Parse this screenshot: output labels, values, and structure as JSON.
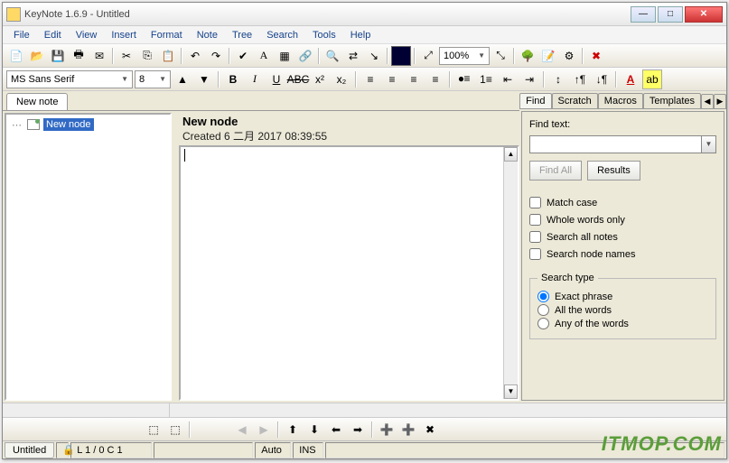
{
  "window": {
    "title": "KeyNote 1.6.9 - Untitled"
  },
  "menu": [
    "File",
    "Edit",
    "View",
    "Insert",
    "Format",
    "Note",
    "Tree",
    "Search",
    "Tools",
    "Help"
  ],
  "format": {
    "font": "MS Sans Serif",
    "size": "8",
    "zoom": "100%"
  },
  "note_tab": "New note",
  "tree": {
    "selected": "New node"
  },
  "editor": {
    "title": "New node",
    "created": "Created 6 二月 2017 08:39:55"
  },
  "find_panel": {
    "tabs": [
      "Find",
      "Scratch",
      "Macros",
      "Templates"
    ],
    "label": "Find text:",
    "value": "",
    "btn_findall": "Find All",
    "btn_results": "Results",
    "chk_match": "Match case",
    "chk_whole": "Whole words only",
    "chk_allnotes": "Search all notes",
    "chk_nodenames": "Search node names",
    "group": "Search type",
    "r_exact": "Exact phrase",
    "r_all": "All the words",
    "r_any": "Any of the words"
  },
  "status": {
    "file": "Untitled",
    "pos": "L 1 / 0  C 1",
    "auto": "Auto",
    "ins": "INS"
  },
  "watermark": "ITMOP.COM"
}
